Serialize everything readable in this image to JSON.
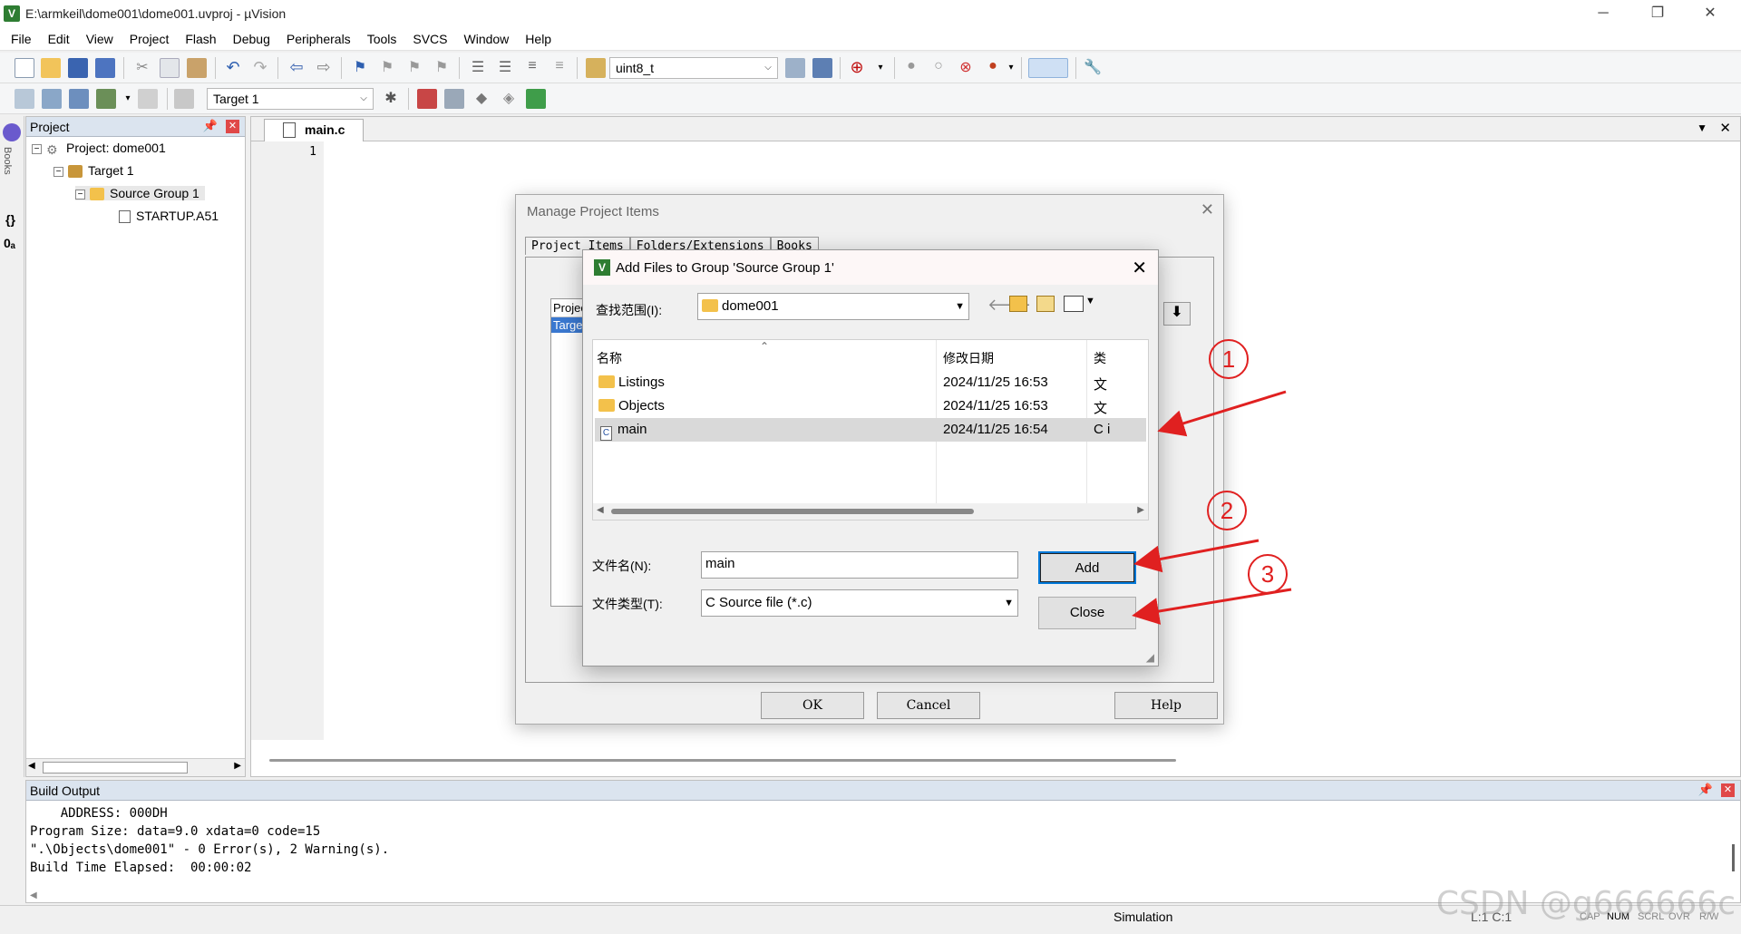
{
  "window": {
    "title": "E:\\armkeil\\dome001\\dome001.uvproj - µVision",
    "minimize": "─",
    "restore": "❐",
    "close": "✕",
    "app_icon": "V"
  },
  "menu": [
    "File",
    "Edit",
    "View",
    "Project",
    "Flash",
    "Debug",
    "Peripherals",
    "Tools",
    "SVCS",
    "Window",
    "Help"
  ],
  "toolbar1": {
    "find_combo": "uint8_t"
  },
  "toolbar2": {
    "target_combo": "Target 1"
  },
  "project_panel": {
    "title": "Project",
    "tree": {
      "project": "Project: dome001",
      "target": "Target 1",
      "group": "Source Group 1",
      "file": "STARTUP.A51"
    }
  },
  "left_strip": {
    "books": "Books",
    "braces": "{}",
    "func": "0ₐ"
  },
  "editor": {
    "tab": "main.c",
    "line_number": "1"
  },
  "build_output": {
    "title": "Build Output",
    "lines": [
      "    ADDRESS: 000DH",
      "Program Size: data=9.0 xdata=0 code=15",
      "\".\\Objects\\dome001\" - 0 Error(s), 2 Warning(s).",
      "Build Time Elapsed:  00:00:02"
    ]
  },
  "status": {
    "simulation": "Simulation",
    "position": "L:1 C:1",
    "caps": "CAP",
    "num": "NUM",
    "scrl": "SCRL",
    "ovr": "OVR",
    "rw": "R/W"
  },
  "manage_dialog": {
    "title": "Manage Project Items",
    "tabs": [
      "Project Items",
      "Folders/Extensions",
      "Books"
    ],
    "list_header": "Projec",
    "list_item": "Targe",
    "ok": "OK",
    "cancel": "Cancel",
    "help": "Help"
  },
  "add_dialog": {
    "title": "Add Files to Group 'Source Group 1'",
    "lookin_label": "查找范围(I):",
    "lookin_value": "dome001",
    "col_name": "名称",
    "col_date": "修改日期",
    "col_type": "类",
    "files": [
      {
        "name": "Listings",
        "date": "2024/11/25 16:53",
        "type": "文",
        "kind": "folder"
      },
      {
        "name": "Objects",
        "date": "2024/11/25 16:53",
        "type": "文",
        "kind": "folder"
      },
      {
        "name": "main",
        "date": "2024/11/25 16:54",
        "type": "C i",
        "kind": "c-file"
      }
    ],
    "filename_label": "文件名(N):",
    "filename_value": "main",
    "filetype_label": "文件类型(T):",
    "filetype_value": "C Source file (*.c)",
    "add": "Add",
    "close": "Close"
  },
  "annotations": [
    "1",
    "2",
    "3"
  ],
  "watermark": "CSDN @g666666c",
  "colors": {
    "arrow": "#e02020",
    "panel_header": "#dbe4ef",
    "selected_row": "#d9d9d9"
  }
}
